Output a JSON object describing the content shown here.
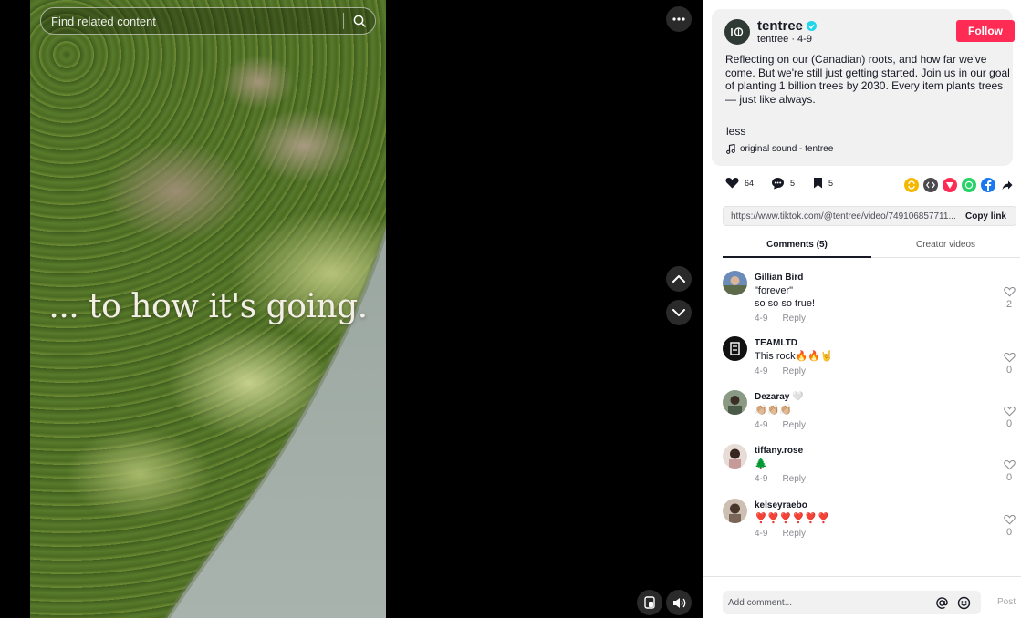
{
  "search": {
    "placeholder": "Find related content"
  },
  "video": {
    "caption": "... to how it's going."
  },
  "post": {
    "author_name": "tentree",
    "author_handle": "tentree",
    "date": "4-9",
    "description": "Reflecting on our (Canadian) roots, and how far we've come. But we're still just getting started. Join us in our goal of planting 1 billion trees by 2030. Every item plants trees — just like always.",
    "less_label": "less",
    "sound": "original sound - tentree",
    "follow_label": "Follow"
  },
  "actions": {
    "likes": "64",
    "comments": "5",
    "saves": "5"
  },
  "share": {
    "url": "https://www.tiktok.com/@tentree/video/749106857711...",
    "copy_label": "Copy link"
  },
  "tabs": [
    {
      "label": "Comments (5)"
    },
    {
      "label": "Creator videos"
    }
  ],
  "comments": [
    {
      "user": "Gillian Bird",
      "text": "\"forever\"\nso so so true!",
      "date": "4-9",
      "reply": "Reply",
      "likes": "2"
    },
    {
      "user": "TEAMLTD",
      "text": "This rock🔥🔥🤘",
      "date": "4-9",
      "reply": "Reply",
      "likes": "0"
    },
    {
      "user": "Dezaray 🤍",
      "text": "👏🏼👏🏼👏🏼",
      "date": "4-9",
      "reply": "Reply",
      "likes": "0"
    },
    {
      "user": "tiffany.rose",
      "text": "🌲",
      "date": "4-9",
      "reply": "Reply",
      "likes": "0"
    },
    {
      "user": "kelseyraebo",
      "text": "❣️❣️❣️❣️❣️❣️",
      "date": "4-9",
      "reply": "Reply",
      "likes": "0"
    }
  ],
  "composer": {
    "placeholder": "Add comment...",
    "post_label": "Post"
  },
  "colors": {
    "accent": "#fe2c55",
    "verified": "#20d5ec"
  }
}
